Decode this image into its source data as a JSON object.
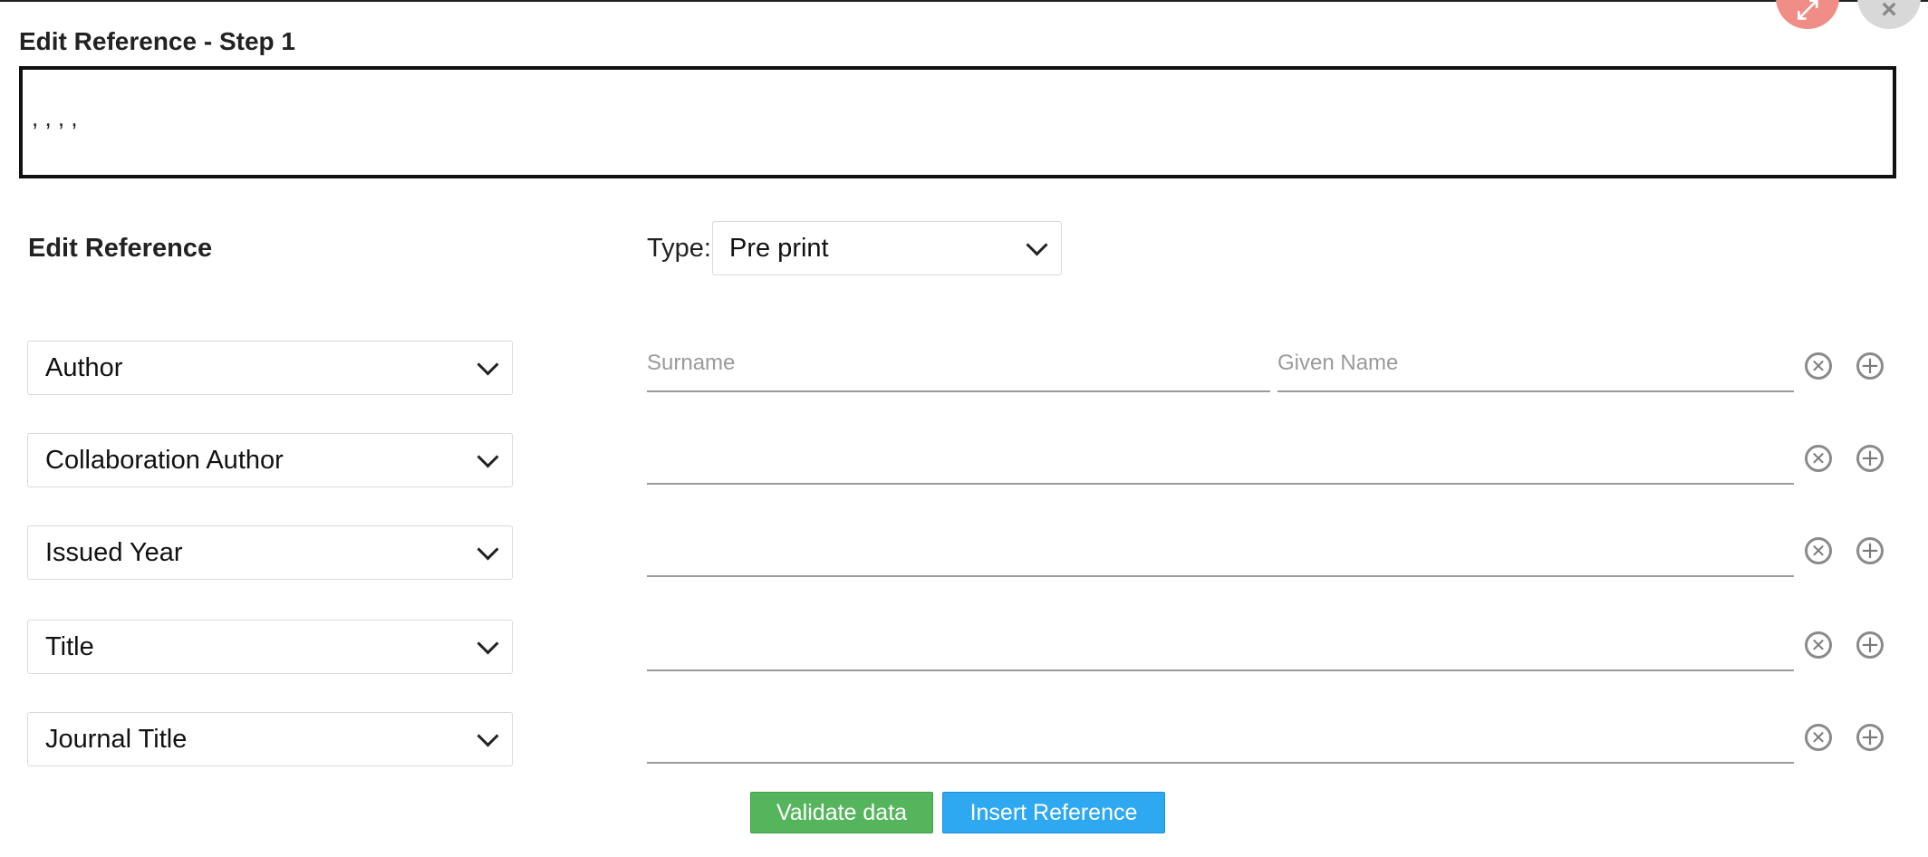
{
  "dialog": {
    "title": "Edit Reference - Step 1",
    "preview_text": ", , , ,",
    "fullscreen_icon": "expand-icon",
    "close_icon": "close-icon"
  },
  "form": {
    "section_title": "Edit Reference",
    "type_label": "Type:",
    "type_value": "Pre print",
    "rows": [
      {
        "field": "Author",
        "inputs": [
          {
            "placeholder": "Surname"
          },
          {
            "placeholder": "Given Name"
          }
        ]
      },
      {
        "field": "Collaboration Author",
        "inputs": [
          {
            "placeholder": ""
          }
        ]
      },
      {
        "field": "Issued Year",
        "inputs": [
          {
            "placeholder": ""
          }
        ]
      },
      {
        "field": "Title",
        "inputs": [
          {
            "placeholder": ""
          }
        ]
      },
      {
        "field": "Journal Title",
        "inputs": [
          {
            "placeholder": ""
          }
        ]
      }
    ],
    "remove_icon": "remove-circle-icon",
    "add_icon": "add-circle-icon"
  },
  "buttons": {
    "validate_label": "Validate data",
    "insert_label": "Insert Reference"
  },
  "colors": {
    "validate": "#55b55c",
    "insert": "#2ea8f0"
  }
}
